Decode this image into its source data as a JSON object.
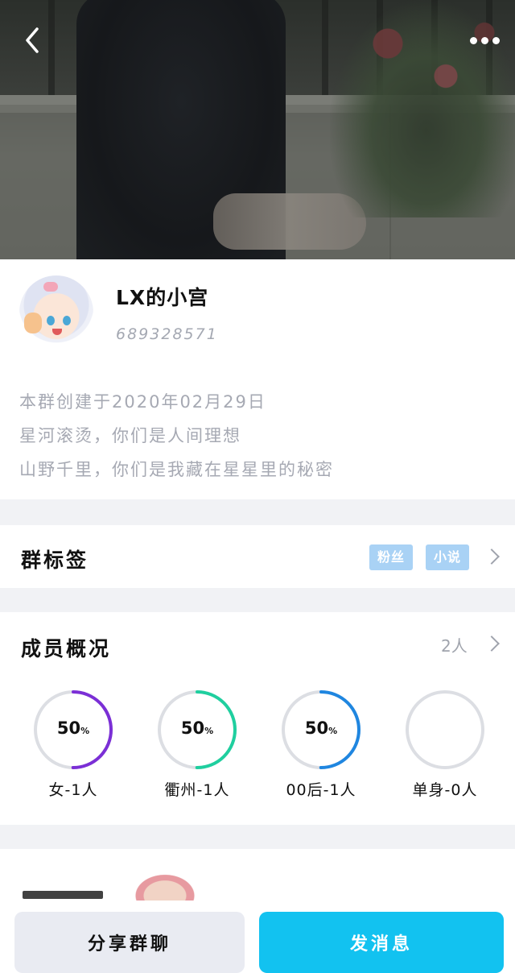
{
  "header": {
    "back_icon": "chevron-left-icon",
    "more_icon": "more-dots-icon"
  },
  "group": {
    "name": "LX的小宫",
    "id": "689328571",
    "description": [
      "本群创建于2020年02月29日",
      "星河滚烫，你们是人间理想",
      "山野千里，你们是我藏在星星里的秘密"
    ]
  },
  "tags_section": {
    "title": "群标签",
    "tags": [
      "粉丝",
      "小说"
    ]
  },
  "members_section": {
    "title": "成员概况",
    "count": "2人",
    "stats": [
      {
        "value": "50",
        "unit": "%",
        "label": "女-1人",
        "fraction": 0.5,
        "color": "#7b2fd6"
      },
      {
        "value": "50",
        "unit": "%",
        "label": "衢州-1人",
        "fraction": 0.5,
        "color": "#1fcf9f"
      },
      {
        "value": "50",
        "unit": "%",
        "label": "00后-1人",
        "fraction": 0.5,
        "color": "#1f86e0"
      },
      {
        "value": "",
        "unit": "",
        "label": "单身-0人",
        "fraction": 0,
        "color": "#1f86e0"
      }
    ]
  },
  "actions": {
    "share_label": "分享群聊",
    "send_label": "发消息"
  },
  "colors": {
    "accent": "#12c2f0",
    "tag_bg": "#a9d2f5"
  }
}
